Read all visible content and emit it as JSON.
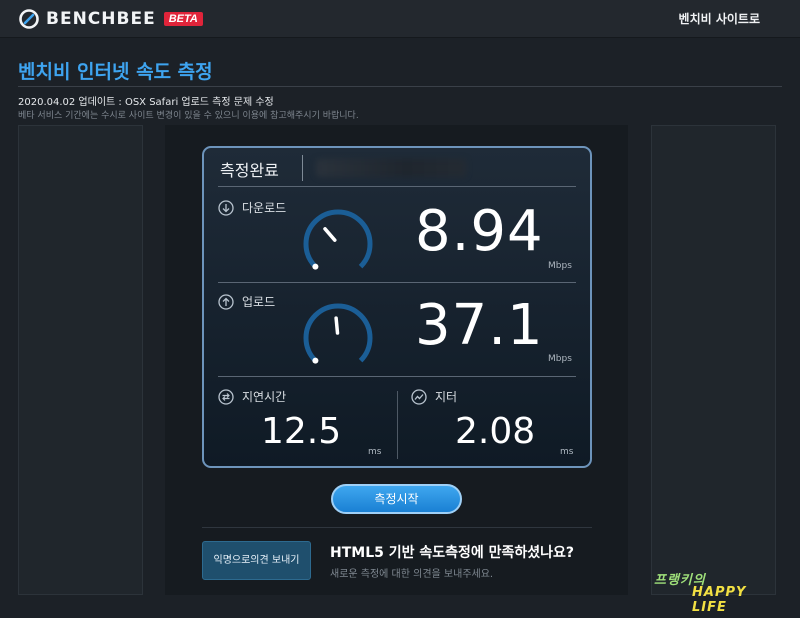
{
  "header": {
    "logo_text": "BENCHBEE",
    "badge": "BETA",
    "site_link": "벤치비 사이트로"
  },
  "page": {
    "title": "벤치비 인터넷 속도 측정",
    "update_note": "2020.04.02 업데이트 : OSX Safari 업로드 측정 문제 수정",
    "beta_note": "베타 서비스 기간에는 수시로 사이트 변경이 있을 수 있으니 이용에 참고해주시기 바랍니다."
  },
  "result": {
    "status": "측정완료",
    "download": {
      "label": "다운로드",
      "value": "8.94",
      "unit": "Mbps",
      "gauge_level": 0.35
    },
    "upload": {
      "label": "업로드",
      "value": "37.1",
      "unit": "Mbps",
      "gauge_level": 0.48
    },
    "latency": {
      "label": "지연시간",
      "value": "12.5",
      "unit": "ms"
    },
    "jitter": {
      "label": "지터",
      "value": "2.08",
      "unit": "ms"
    }
  },
  "actions": {
    "start_label": "측정시작",
    "feedback_button": "익명으로의견 보내기",
    "feedback_title": "HTML5 기반 속도측정에 만족하셨나요?",
    "feedback_sub": "새로운 측정에 대한 의견을 보내주세요."
  },
  "watermark": {
    "line1": "프랭키의",
    "line2": "HAPPY LIFE"
  },
  "colors": {
    "accent": "#3ea4f0",
    "badge": "#e0243a",
    "gauge_track": "#1b5e96",
    "card_border": "#6d94bb"
  }
}
